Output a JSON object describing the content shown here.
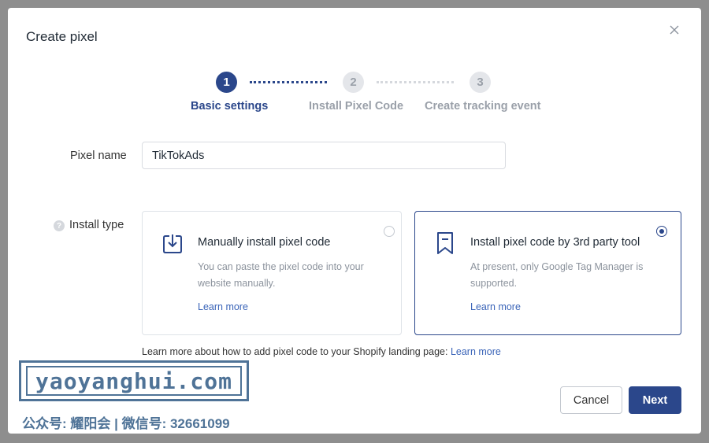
{
  "dialog": {
    "title": "Create pixel"
  },
  "stepper": {
    "steps": [
      {
        "number": "1",
        "label": "Basic settings"
      },
      {
        "number": "2",
        "label": "Install Pixel Code"
      },
      {
        "number": "3",
        "label": "Create tracking event"
      }
    ],
    "current_step": 1
  },
  "form": {
    "pixel_name_label": "Pixel name",
    "pixel_name_value": "TikTokAds",
    "install_type_label": "Install type",
    "help_icon_glyph": "?",
    "options": [
      {
        "title": "Manually install pixel code",
        "description": "You can paste the pixel code into your website manually.",
        "link": "Learn more",
        "icon": "download-box-icon",
        "selected": false
      },
      {
        "title": "Install pixel code by 3rd party tool",
        "description": "At present, only Google Tag Manager is supported.",
        "link": "Learn more",
        "icon": "bookmark-icon",
        "selected": true
      }
    ],
    "footer_note": "Learn more about how to add pixel code to your Shopify landing page:",
    "footer_link": "Learn more"
  },
  "actions": {
    "cancel_label": "Cancel",
    "next_label": "Next"
  },
  "watermark": {
    "text": "yaoyanghui.com",
    "caption": "公众号: 耀阳会 | 微信号: 32661099"
  },
  "colors": {
    "accent": "#2b478b",
    "link": "#3a64b8",
    "muted": "#9aa0a9",
    "watermark": "#4f7397"
  }
}
